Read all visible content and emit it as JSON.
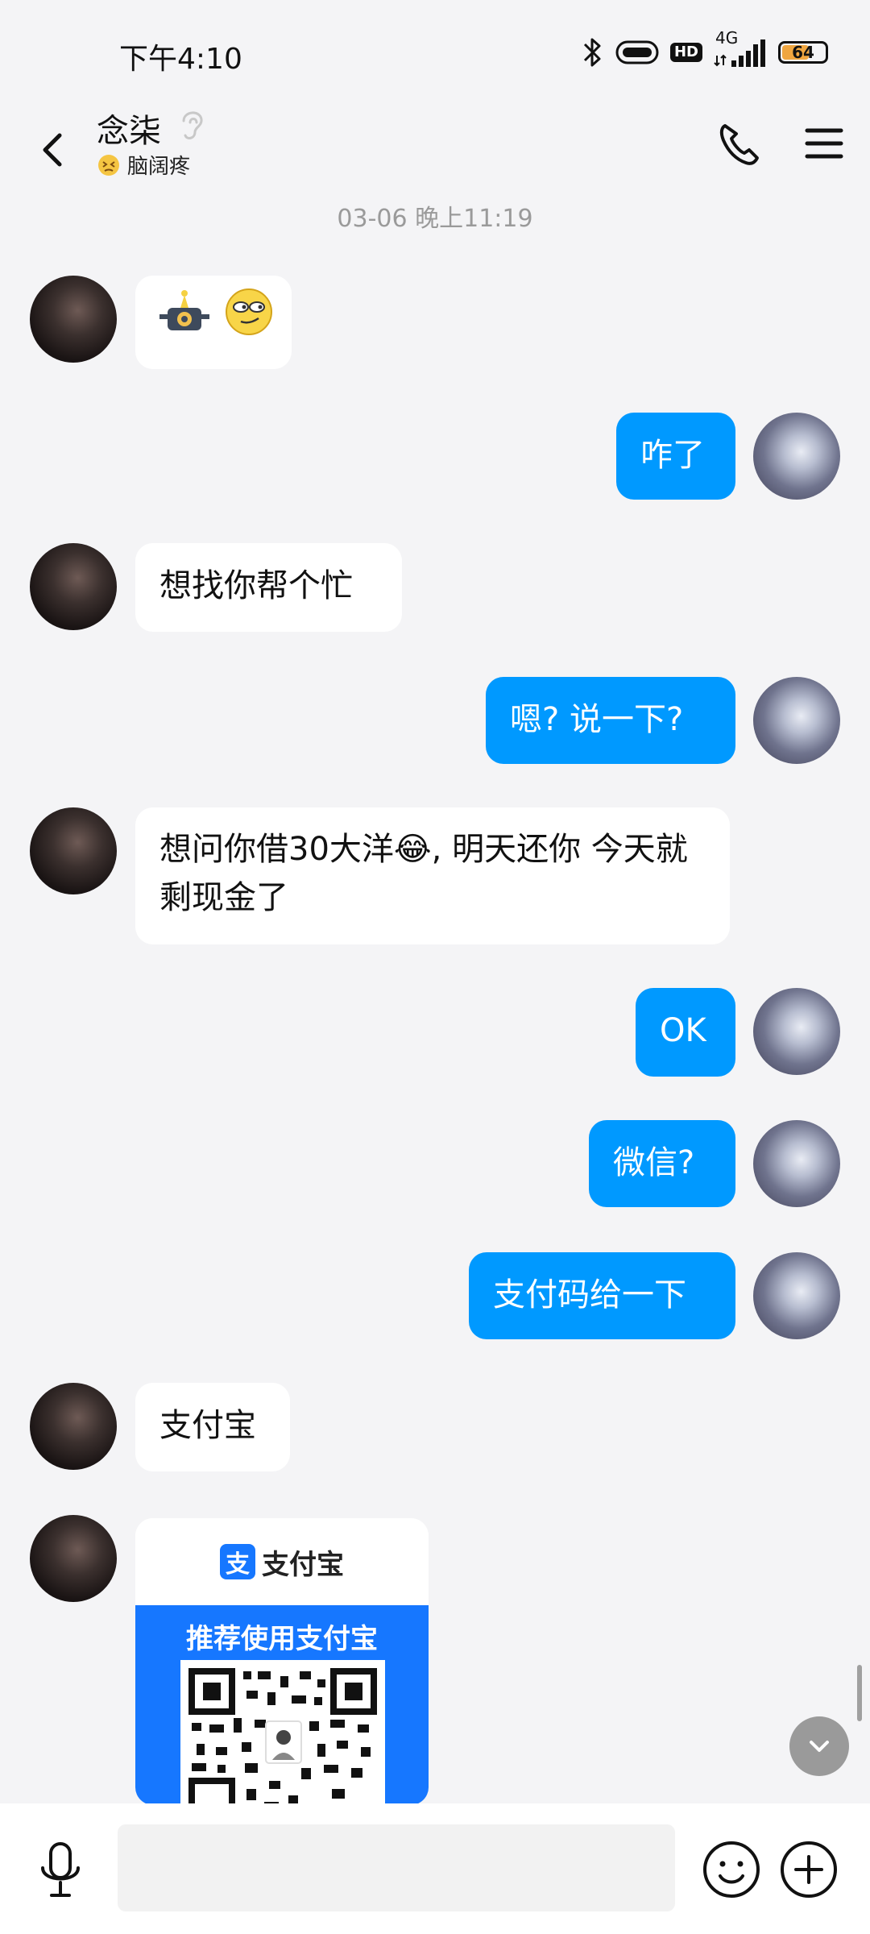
{
  "status_bar": {
    "time": "下午4:10",
    "hd_label": "HD",
    "network_label": "4G",
    "battery_level": "64",
    "battery_fraction": 0.64
  },
  "header": {
    "contact_name": "念柒",
    "status_text": "脑阔疼"
  },
  "timestamp": "03-06 晚上11:19",
  "messages": [
    {
      "side": "in",
      "type": "sticker",
      "icons": [
        "robot-sticker-icon",
        "smirk-emoji-icon"
      ]
    },
    {
      "side": "out",
      "text": "咋了"
    },
    {
      "side": "in",
      "text": "想找你帮个忙"
    },
    {
      "side": "out",
      "text": "嗯? 说一下?"
    },
    {
      "side": "in",
      "text_before_emoji": "想问你借30大洋",
      "emoji": "😂",
      "text_after_emoji": ", 明天还你  今天就剩现金了"
    },
    {
      "side": "out",
      "text": "OK"
    },
    {
      "side": "out",
      "text": "微信?"
    },
    {
      "side": "out",
      "text": "支付码给一下"
    },
    {
      "side": "in",
      "text": "支付宝"
    },
    {
      "side": "in",
      "type": "qr-card",
      "logo_char": "支",
      "brand": "支付宝",
      "banner": "推荐使用支付宝"
    }
  ],
  "colors": {
    "accent": "#0099ff",
    "background": "#f4f4f6",
    "incoming_bubble": "#ffffff",
    "alipay_blue": "#1677ff"
  },
  "icons": {
    "back": "chevron-left-icon",
    "ear": "ear-icon",
    "call": "phone-icon",
    "menu": "menu-icon",
    "mic": "microphone-icon",
    "emoji": "smiley-icon",
    "plus": "plus-icon",
    "scroll_down": "chevron-down-icon"
  }
}
